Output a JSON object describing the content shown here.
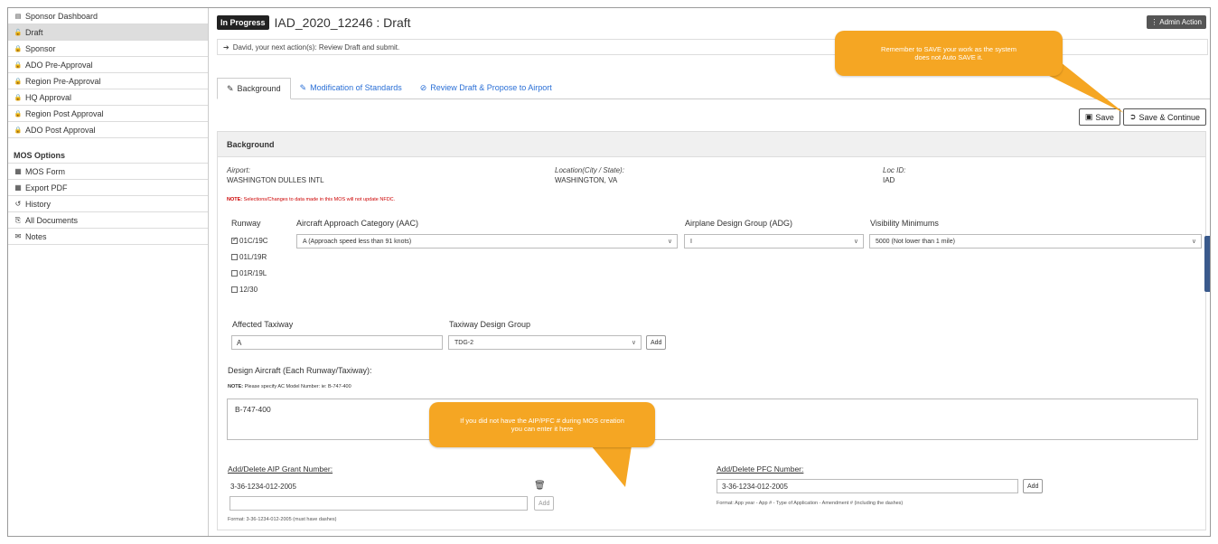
{
  "sidebar": {
    "items": [
      {
        "label": "Sponsor Dashboard",
        "icon": "grid-icon",
        "glyph": "▤",
        "active": false
      },
      {
        "label": "Draft",
        "icon": "unlock-icon",
        "glyph": "🔓",
        "active": true
      },
      {
        "label": "Sponsor",
        "icon": "lock-icon",
        "glyph": "🔒",
        "active": false
      },
      {
        "label": "ADO Pre-Approval",
        "icon": "lock-icon",
        "glyph": "🔒",
        "active": false
      },
      {
        "label": "Region Pre-Approval",
        "icon": "lock-icon",
        "glyph": "🔒",
        "active": false
      },
      {
        "label": "HQ Approval",
        "icon": "lock-icon",
        "glyph": "🔒",
        "active": false
      },
      {
        "label": "Region Post Approval",
        "icon": "lock-icon",
        "glyph": "🔒",
        "active": false
      },
      {
        "label": "ADO Post Approval",
        "icon": "lock-icon",
        "glyph": "🔒",
        "active": false
      }
    ],
    "section_title": "MOS Options",
    "options": [
      {
        "label": "MOS Form",
        "icon": "form-icon",
        "glyph": "▦"
      },
      {
        "label": "Export PDF",
        "icon": "pdf-icon",
        "glyph": "▦"
      },
      {
        "label": "History",
        "icon": "history-icon",
        "glyph": "↺"
      },
      {
        "label": "All Documents",
        "icon": "paperclip-icon",
        "glyph": "⎘"
      },
      {
        "label": "Notes",
        "icon": "comments-icon",
        "glyph": "✉"
      }
    ]
  },
  "header": {
    "status_badge": "In Progress",
    "title": "IAD_2020_12246 : Draft",
    "admin_action": "Admin Action",
    "next_action": "David, your next action(s): Review Draft and submit."
  },
  "tabs": [
    {
      "label": "Background",
      "icon": "edit-icon",
      "glyph": "✎",
      "active": true
    },
    {
      "label": "Modification of Standards",
      "icon": "pencil-icon",
      "glyph": "✎",
      "active": false
    },
    {
      "label": "Review Draft & Propose to Airport",
      "icon": "check-circle-icon",
      "glyph": "⊘",
      "active": false
    }
  ],
  "buttons": {
    "save": "Save",
    "save_continue": "Save & Continue"
  },
  "background": {
    "heading": "Background",
    "airport_label": "Airport:",
    "airport_value": "WASHINGTON DULLES INTL",
    "location_label": "Location(City / State):",
    "location_value": "WASHINGTON, VA",
    "locid_label": "Loc ID:",
    "locid_value": "IAD",
    "note_prefix": "NOTE:",
    "note_text": " Selections/Changes to data made in this MOS will not update NFDC."
  },
  "runway_section": {
    "runway_label": "Runway",
    "aac_label": "Aircraft Approach Category (AAC)",
    "adg_label": "Airplane Design Group (ADG)",
    "vis_label": "Visibility Minimums",
    "runways": [
      {
        "label": "01C/19C",
        "checked": true
      },
      {
        "label": "01L/19R",
        "checked": false
      },
      {
        "label": "01R/19L",
        "checked": false
      },
      {
        "label": "12/30",
        "checked": false
      }
    ],
    "aac_value": "A (Approach speed less than 91 knots)",
    "adg_value": "I",
    "vis_value": "5000 (Not lower than 1 mile)"
  },
  "taxiway": {
    "affected_label": "Affected Taxiway",
    "affected_value": "A",
    "tdg_label": "Taxiway Design Group",
    "tdg_value": "TDG-2",
    "add": "Add"
  },
  "design_aircraft": {
    "label": "Design Aircraft (Each Runway/Taxiway):",
    "note_prefix": "NOTE:",
    "note_text": " Please specify AC Model Number: ie: B-747-400",
    "value": "B-747-400"
  },
  "aip": {
    "label": "Add/Delete AIP Grant Number:",
    "existing": "3-36-1234-012-2005",
    "input_value": "",
    "add": "Add",
    "format": "Format: 3-36-1234-012-2005 (must have dashes)"
  },
  "pfc": {
    "label": "Add/Delete PFC Number:",
    "value": "3-36-1234-012-2005",
    "add": "Add",
    "format": "Format: App year - App # - Type of Application - Amendment # (including the dashes)"
  },
  "callouts": {
    "save_tip": "Remember to SAVE your work as the system does not Auto SAVE it.",
    "aip_tip": "If you did not have the AIP/PFC # during MOS creation you can enter it here"
  },
  "colors": {
    "callout": "#f5a623",
    "link": "#2a6fd6",
    "note": "#cc0000"
  }
}
